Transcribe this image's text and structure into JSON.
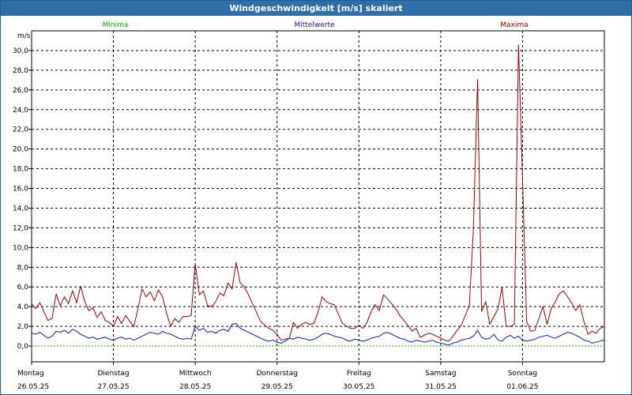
{
  "window": {
    "title": "Windgeschwindigkeit [m/s] skaliert"
  },
  "colors": {
    "minima": "#00b000",
    "mittelwerte": "#1010cc",
    "maxima": "#a00000",
    "grid": "#000000",
    "titlebar": "#2f6ea8"
  },
  "chart_data": {
    "type": "line",
    "title": "Windgeschwindigkeit [m/s] skaliert",
    "ylabel": "m/s",
    "ylim": [
      -1.6,
      32.0
    ],
    "yticks": [
      0,
      2,
      4,
      6,
      8,
      10,
      12,
      14,
      16,
      18,
      20,
      22,
      24,
      26,
      28,
      30
    ],
    "ytick_labels": [
      "0,0",
      "2,0",
      "4,0",
      "6,0",
      "8,0",
      "10,0",
      "12,0",
      "14,0",
      "16,0",
      "18,0",
      "20,0",
      "22,0",
      "24,0",
      "26,0",
      "28,0",
      "30,0"
    ],
    "xlim": [
      0,
      7
    ],
    "days": [
      {
        "name": "Montag",
        "date": "26.05.25"
      },
      {
        "name": "Dienstag",
        "date": "27.05.25"
      },
      {
        "name": "Mittwoch",
        "date": "28.05.25"
      },
      {
        "name": "Donnerstag",
        "date": "29.05.25"
      },
      {
        "name": "Freitag",
        "date": "30.05.25"
      },
      {
        "name": "Samstag",
        "date": "31.05.25"
      },
      {
        "name": "Sonntag",
        "date": "01.06.25"
      }
    ],
    "grid": true,
    "legend_position": "top",
    "series": [
      {
        "name": "Minima",
        "color": "#00b000",
        "x": [
          0,
          7
        ],
        "values": [
          0.0,
          0.0
        ]
      },
      {
        "name": "Mittelwerte",
        "color": "#1010cc",
        "x": [
          0.0,
          0.05,
          0.1,
          0.15,
          0.2,
          0.25,
          0.3,
          0.35,
          0.4,
          0.45,
          0.5,
          0.55,
          0.6,
          0.65,
          0.7,
          0.75,
          0.8,
          0.85,
          0.9,
          0.95,
          1.0,
          1.05,
          1.1,
          1.15,
          1.2,
          1.25,
          1.3,
          1.35,
          1.4,
          1.45,
          1.5,
          1.55,
          1.6,
          1.65,
          1.7,
          1.75,
          1.8,
          1.85,
          1.9,
          1.95,
          2.0,
          2.05,
          2.1,
          2.15,
          2.2,
          2.25,
          2.3,
          2.35,
          2.4,
          2.45,
          2.5,
          2.55,
          2.6,
          2.65,
          2.7,
          2.75,
          2.8,
          2.85,
          2.9,
          2.95,
          3.0,
          3.05,
          3.1,
          3.15,
          3.2,
          3.25,
          3.3,
          3.35,
          3.4,
          3.45,
          3.5,
          3.55,
          3.6,
          3.65,
          3.7,
          3.75,
          3.8,
          3.85,
          3.9,
          3.95,
          4.0,
          4.05,
          4.1,
          4.15,
          4.2,
          4.25,
          4.3,
          4.35,
          4.4,
          4.45,
          4.5,
          4.55,
          4.6,
          4.65,
          4.7,
          4.75,
          4.8,
          4.85,
          4.9,
          4.95,
          5.0,
          5.05,
          5.1,
          5.15,
          5.2,
          5.25,
          5.3,
          5.35,
          5.4,
          5.45,
          5.5,
          5.55,
          5.6,
          5.65,
          5.7,
          5.75,
          5.8,
          5.85,
          5.9,
          5.95,
          6.0,
          6.05,
          6.1,
          6.15,
          6.2,
          6.25,
          6.3,
          6.35,
          6.4,
          6.45,
          6.5,
          6.55,
          6.6,
          6.65,
          6.7,
          6.75,
          6.8,
          6.85,
          6.9,
          6.95,
          7.0
        ],
        "values": [
          1.3,
          1.2,
          1.4,
          1.1,
          0.8,
          1.0,
          1.5,
          1.4,
          1.6,
          1.3,
          1.7,
          1.5,
          1.2,
          1.0,
          0.8,
          0.9,
          0.7,
          0.8,
          0.9,
          0.7,
          0.6,
          0.8,
          0.9,
          0.7,
          0.8,
          0.6,
          0.8,
          1.0,
          1.2,
          1.4,
          1.3,
          1.2,
          1.5,
          1.3,
          1.2,
          1.0,
          0.8,
          0.7,
          0.8,
          0.7,
          2.0,
          1.6,
          1.8,
          1.4,
          1.5,
          1.3,
          1.6,
          1.7,
          1.5,
          2.2,
          2.3,
          1.8,
          1.6,
          1.4,
          1.2,
          1.0,
          0.8,
          0.6,
          0.5,
          0.6,
          0.4,
          0.3,
          0.5,
          0.8,
          0.7,
          0.9,
          0.8,
          0.7,
          0.6,
          0.7,
          0.9,
          1.2,
          1.3,
          1.2,
          1.0,
          0.9,
          0.8,
          0.6,
          0.5,
          0.7,
          0.6,
          0.5,
          0.6,
          0.8,
          0.9,
          1.0,
          1.3,
          1.4,
          1.2,
          1.0,
          0.8,
          0.7,
          0.5,
          0.4,
          0.6,
          0.5,
          0.4,
          0.5,
          0.6,
          0.4,
          0.3,
          0.2,
          0.1,
          0.3,
          0.4,
          0.6,
          0.7,
          0.8,
          1.0,
          1.6,
          0.9,
          0.7,
          0.8,
          1.2,
          0.6,
          0.5,
          0.9,
          1.1,
          0.8,
          1.0,
          0.6,
          0.5,
          0.6,
          0.7,
          0.9,
          1.0,
          1.1,
          0.9,
          0.8,
          1.0,
          1.2,
          1.4,
          1.3,
          1.1,
          0.9,
          0.6,
          0.5,
          0.3,
          0.4,
          0.5,
          0.6
        ]
      },
      {
        "name": "Maxima",
        "color": "#a00000",
        "x": [
          0.0,
          0.05,
          0.1,
          0.15,
          0.2,
          0.25,
          0.3,
          0.35,
          0.4,
          0.45,
          0.5,
          0.55,
          0.6,
          0.65,
          0.7,
          0.75,
          0.8,
          0.85,
          0.9,
          0.95,
          1.0,
          1.05,
          1.1,
          1.15,
          1.2,
          1.25,
          1.3,
          1.35,
          1.4,
          1.45,
          1.5,
          1.55,
          1.6,
          1.65,
          1.7,
          1.75,
          1.8,
          1.85,
          1.9,
          1.95,
          2.0,
          2.05,
          2.1,
          2.15,
          2.2,
          2.25,
          2.3,
          2.35,
          2.4,
          2.45,
          2.5,
          2.55,
          2.6,
          2.65,
          2.7,
          2.75,
          2.8,
          2.85,
          2.9,
          2.95,
          3.0,
          3.05,
          3.1,
          3.15,
          3.2,
          3.25,
          3.3,
          3.35,
          3.4,
          3.45,
          3.5,
          3.55,
          3.6,
          3.65,
          3.7,
          3.75,
          3.8,
          3.85,
          3.9,
          3.95,
          4.0,
          4.05,
          4.1,
          4.15,
          4.2,
          4.25,
          4.3,
          4.35,
          4.4,
          4.45,
          4.5,
          4.55,
          4.6,
          4.65,
          4.7,
          4.75,
          4.8,
          4.85,
          4.9,
          4.95,
          5.0,
          5.05,
          5.1,
          5.15,
          5.2,
          5.25,
          5.3,
          5.35,
          5.4,
          5.45,
          5.5,
          5.55,
          5.6,
          5.65,
          5.7,
          5.75,
          5.8,
          5.85,
          5.9,
          5.95,
          6.0,
          6.05,
          6.1,
          6.15,
          6.2,
          6.25,
          6.3,
          6.35,
          6.4,
          6.45,
          6.5,
          6.55,
          6.6,
          6.65,
          6.7,
          6.75,
          6.8,
          6.85,
          6.9,
          6.95,
          7.0
        ],
        "values": [
          4.3,
          3.8,
          4.4,
          3.5,
          2.6,
          2.8,
          5.3,
          4.1,
          5.0,
          4.3,
          5.6,
          4.4,
          6.1,
          4.5,
          3.6,
          3.9,
          2.9,
          3.5,
          2.6,
          2.4,
          2.0,
          3.0,
          2.3,
          3.1,
          2.5,
          2.0,
          3.8,
          5.8,
          5.0,
          5.5,
          4.6,
          5.7,
          5.0,
          3.3,
          2.0,
          2.8,
          2.4,
          3.0,
          3.0,
          3.1,
          8.4,
          5.2,
          5.6,
          4.1,
          4.0,
          4.5,
          5.4,
          5.1,
          6.4,
          5.8,
          8.5,
          6.4,
          6.0,
          5.2,
          4.3,
          3.4,
          2.5,
          2.1,
          1.8,
          1.6,
          1.2,
          0.6,
          0.7,
          0.8,
          2.4,
          1.8,
          2.2,
          2.4,
          2.2,
          2.3,
          3.4,
          5.0,
          4.5,
          4.3,
          4.2,
          3.2,
          2.3,
          2.0,
          1.8,
          1.8,
          2.1,
          1.8,
          2.4,
          3.5,
          4.2,
          3.6,
          5.2,
          4.8,
          4.3,
          3.8,
          3.1,
          2.6,
          2.1,
          1.5,
          1.8,
          0.9,
          1.1,
          1.3,
          1.2,
          1.0,
          0.8,
          0.6,
          0.5,
          1.0,
          1.6,
          2.1,
          3.1,
          4.1,
          12.0,
          27.1,
          3.5,
          4.5,
          2.2,
          3.0,
          3.8,
          6.0,
          2.0,
          2.0,
          2.2,
          30.6,
          17.0,
          2.5,
          1.5,
          1.6,
          2.8,
          4.0,
          2.2,
          3.8,
          4.5,
          5.3,
          5.6,
          5.0,
          4.4,
          3.6,
          4.2,
          2.5,
          1.2,
          1.5,
          1.3,
          1.8,
          2.0
        ]
      }
    ]
  }
}
